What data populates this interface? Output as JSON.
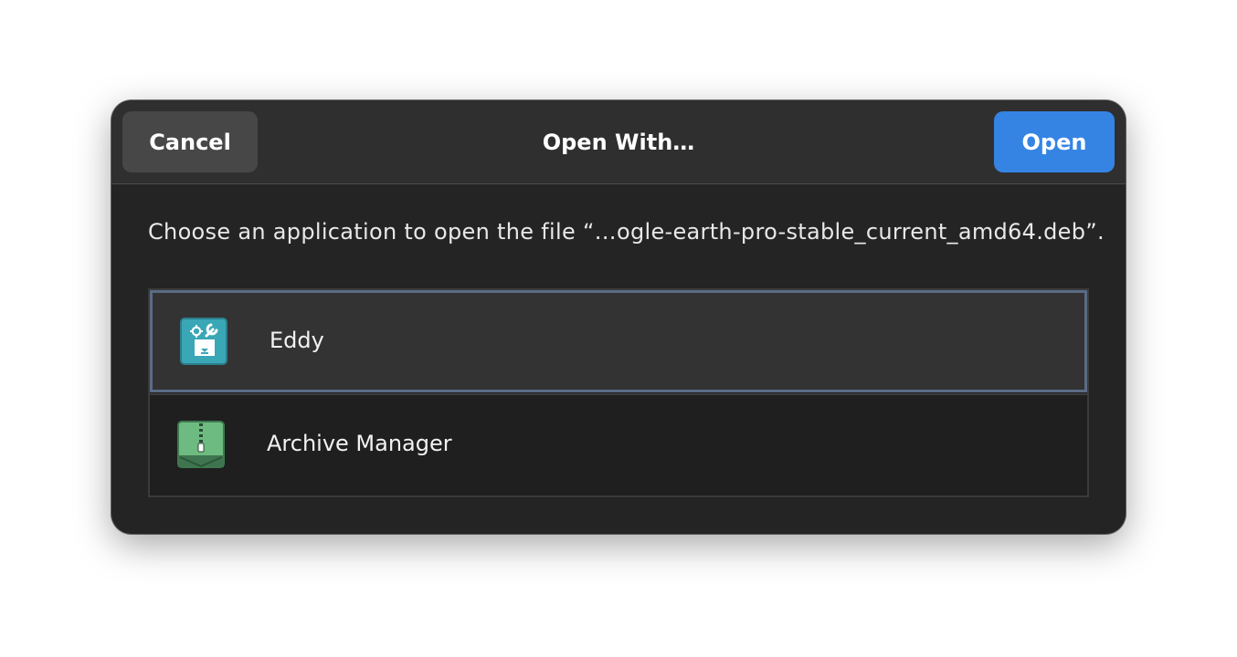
{
  "dialog": {
    "title": "Open With…",
    "cancel_label": "Cancel",
    "open_label": "Open",
    "message": "Choose an application to open the file “…ogle-earth-pro-stable_current_amd64.deb”."
  },
  "apps": [
    {
      "label": "Eddy",
      "icon": "eddy-icon",
      "selected": true
    },
    {
      "label": "Archive Manager",
      "icon": "archive-manager-icon",
      "selected": false
    }
  ],
  "colors": {
    "accent": "#3584e4",
    "selection_border": "#5a6b85",
    "eddy_icon_bg": "#3aa7b6",
    "archive_icon_bg": "#6dbb80"
  }
}
